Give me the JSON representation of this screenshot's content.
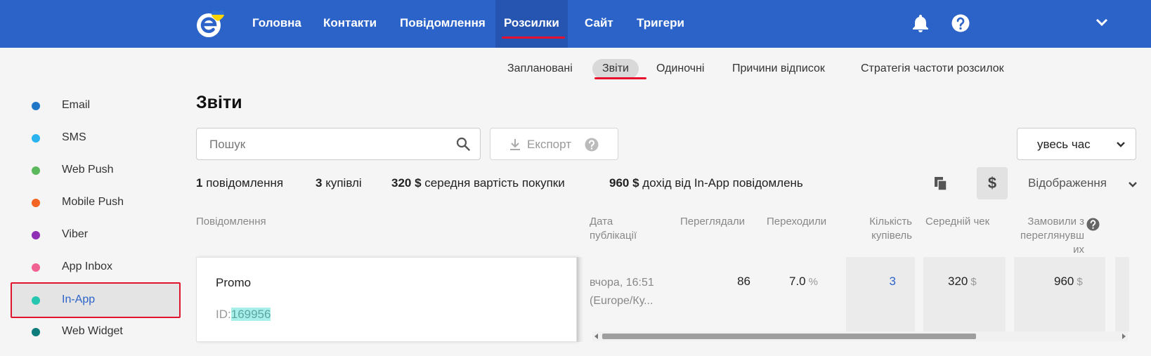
{
  "nav": {
    "items": [
      "Головна",
      "Контакти",
      "Повідомлення",
      "Розсилки",
      "Сайт",
      "Тригери"
    ],
    "active_index": 3
  },
  "subnav": {
    "items": [
      "Заплановані",
      "Звіти",
      "Одиночні",
      "Причини відписок",
      "Стратегія частоти розсилок"
    ],
    "active_index": 1
  },
  "sidebar": {
    "items": [
      {
        "label": "Email",
        "color": "#1f77c8"
      },
      {
        "label": "SMS",
        "color": "#2ab3ef"
      },
      {
        "label": "Web Push",
        "color": "#5cb85c"
      },
      {
        "label": "Mobile Push",
        "color": "#f26522"
      },
      {
        "label": "Viber",
        "color": "#8e2fb5"
      },
      {
        "label": "App Inbox",
        "color": "#f06292"
      },
      {
        "label": "In-App",
        "color": "#26c6b0"
      },
      {
        "label": "Web Widget",
        "color": "#0e7c7b"
      }
    ],
    "active_index": 6
  },
  "page": {
    "title": "Звіти",
    "search_placeholder": "Пошук",
    "export_label": "Експорт",
    "period_label": "увесь час",
    "display_label": "Відображення",
    "currency_symbol": "$"
  },
  "stats": [
    {
      "value": "1",
      "label": "повідомлення"
    },
    {
      "value": "3",
      "label": "купівлі"
    },
    {
      "value": "320 $",
      "label": "середня вартість покупки"
    },
    {
      "value": "960 $",
      "label": "дохід від In-App повідомлень"
    }
  ],
  "table": {
    "headers": {
      "message": "Повідомлення",
      "date": [
        "Дата",
        "публікації"
      ],
      "views": "Переглядали",
      "clicks": "Переходили",
      "purchases": [
        "Кількість",
        "купівель"
      ],
      "avg_check": "Середній чек",
      "ordered": [
        "Замовили з",
        "переглянувш",
        "их"
      ]
    },
    "rows": [
      {
        "name": "Promo",
        "id_prefix": "ID:",
        "id": "169956",
        "date": [
          "вчора, 16:51",
          "(Europe/Ку..."
        ],
        "views": "86",
        "clicks": "7.0",
        "clicks_unit": "%",
        "purchases": "3",
        "avg_check": "320",
        "avg_check_unit": "$",
        "ordered": "960",
        "ordered_unit": "$"
      }
    ]
  },
  "colors": {
    "topbar": "#2c63c8",
    "accent_red": "#e8112d",
    "link": "#2c63c8"
  }
}
